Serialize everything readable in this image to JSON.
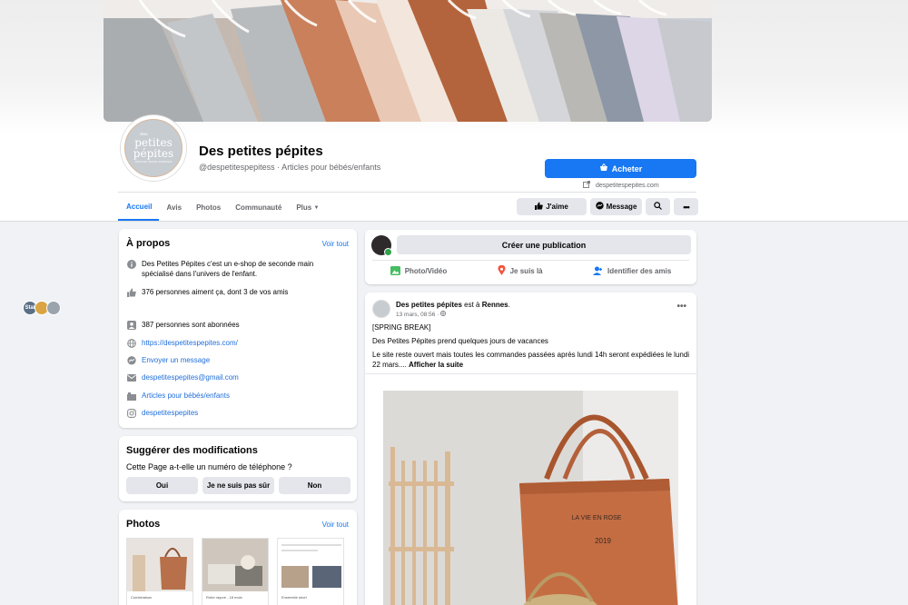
{
  "page": {
    "name": "Des petites pépites",
    "subtitle": "@despetitespepitess · Articles pour bébés/enfants",
    "avatar_text": {
      "small": "des",
      "line1": "petites",
      "line2": "pépites",
      "tag": "SECOND HAND KIDSHOP"
    }
  },
  "header": {
    "buy_label": "Acheter",
    "website": "despetitespepites.com"
  },
  "tabs": [
    {
      "label": "Accueil",
      "active": true
    },
    {
      "label": "Avis"
    },
    {
      "label": "Photos"
    },
    {
      "label": "Communauté"
    },
    {
      "label": "Plus"
    }
  ],
  "actions": {
    "like": "J'aime",
    "message": "Message"
  },
  "about": {
    "title": "À propos",
    "see_all": "Voir tout",
    "description": "Des Petites Pépites c'est un e-shop de seconde main spécialisé dans l'univers de l'enfant.",
    "likes": "376 personnes aiment ça, dont 3 de vos amis",
    "followers": "387 personnes sont abonnées",
    "website": "https://despetitespepites.com/",
    "send_message": "Envoyer un message",
    "email": "despetitespepites@gmail.com",
    "category": "Articles pour bébés/enfants",
    "instagram": "despetitespepites",
    "friend_avatar_label": "Stal"
  },
  "suggest": {
    "title": "Suggérer des modifications",
    "question": "Cette Page a-t-elle un numéro de téléphone ?",
    "options": [
      "Oui",
      "Je ne suis pas sûr",
      "Non"
    ]
  },
  "photos": {
    "title": "Photos",
    "see_all": "Voir tout",
    "captions": [
      "Combinaison",
      "Robe rayure - 18 mois",
      "Ensemble short"
    ]
  },
  "composer": {
    "create": "Créer une publication",
    "photo_video": "Photo/Vidéo",
    "location": "Je suis là",
    "tag": "Identifier des amis"
  },
  "post": {
    "author": "Des petites pépites",
    "location_text": "est à",
    "location": "Rennes",
    "date": "13 mars, 08:56 ·",
    "line1": "[SPRING BREAK]",
    "line2": "Des Petites Pépites prend quelques jours de vacances",
    "line3": "Le site reste ouvert mais toutes les commandes passées après lundi 14h seront expédiées le lundi 22 mars....",
    "see_more": "Afficher la suite",
    "bag_text1": "LA VIE EN ROSE",
    "bag_text2": "2019"
  },
  "colors": {
    "primary": "#1877f2",
    "background": "#f0f2f5",
    "button_grey": "#e4e6eb",
    "secondary_text": "#65676b"
  }
}
